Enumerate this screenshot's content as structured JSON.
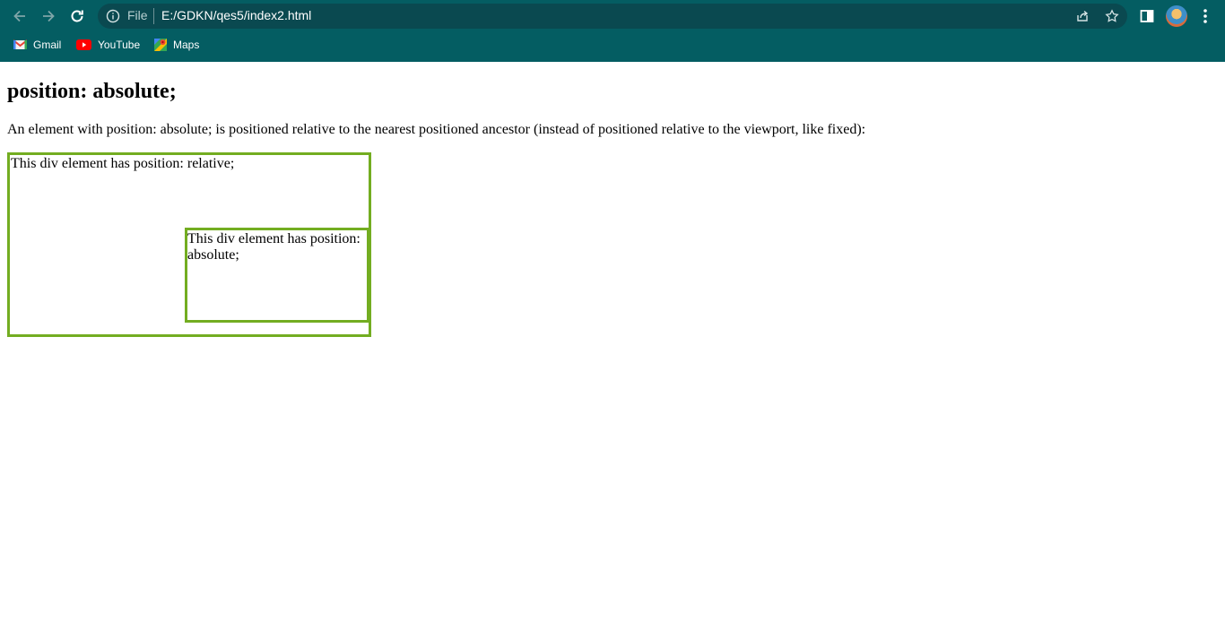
{
  "browser": {
    "address_scheme_label": "File",
    "url": "E:/GDKN/qes5/index2.html",
    "bookmarks": [
      {
        "label": "Gmail",
        "icon": "gmail-icon"
      },
      {
        "label": "YouTube",
        "icon": "youtube-icon"
      },
      {
        "label": "Maps",
        "icon": "maps-icon"
      }
    ],
    "theme_color": "#045d62"
  },
  "page": {
    "heading": "position: absolute;",
    "intro": "An element with position: absolute; is positioned relative to the nearest positioned ancestor (instead of positioned relative to the viewport, like fixed):",
    "relative_box_text": "This div element has position: relative;",
    "absolute_box_text": "This div element has position: absolute;",
    "border_color": "#73AD21"
  }
}
